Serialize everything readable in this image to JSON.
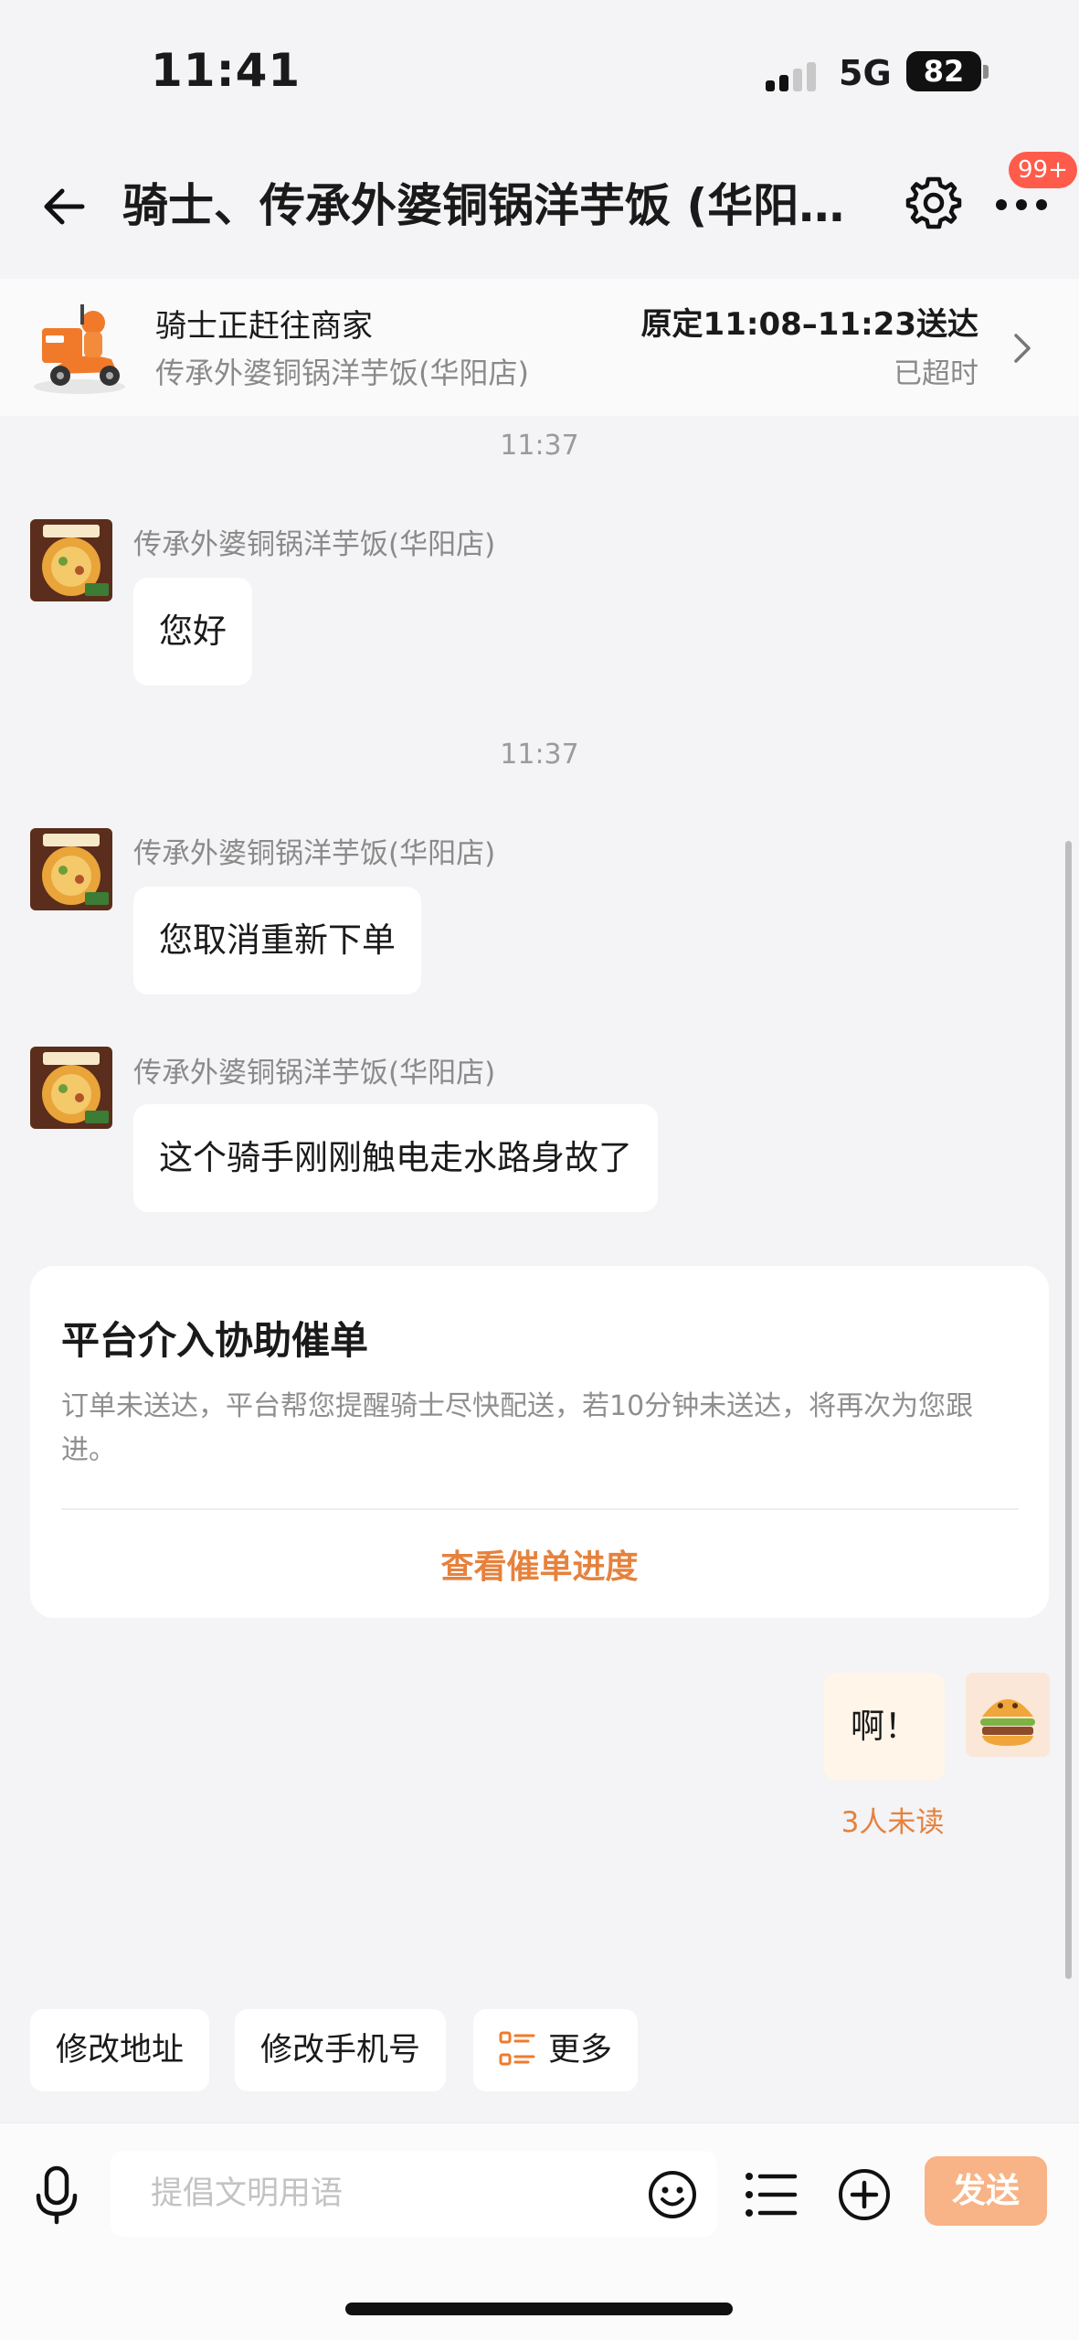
{
  "status_bar": {
    "time": "11:41",
    "network": "5G",
    "battery": "82"
  },
  "header": {
    "title": "骑士、传承外婆铜锅洋芋饭 (华阳…",
    "badge": "99+"
  },
  "order": {
    "rider_status": "骑士正赶往商家",
    "shop_name": "传承外婆铜锅洋芋饭(华阳店)",
    "eta": "原定11:08–11:23送达",
    "overtime": "已超时"
  },
  "messages": [
    {
      "time": "11:37",
      "sender": "传承外婆铜锅洋芋饭(华阳店)",
      "text": "您好"
    },
    {
      "time": "11:37",
      "sender": "传承外婆铜锅洋芋饭(华阳店)",
      "text": "您取消重新下单"
    },
    {
      "sender": "传承外婆铜锅洋芋饭(华阳店)",
      "text": "这个骑手刚刚触电走水路身故了"
    }
  ],
  "platform_card": {
    "title": "平台介入协助催单",
    "desc": "订单未送达，平台帮您提醒骑士尽快配送，若10分钟未送达，将再次为您跟进。",
    "link": "查看催单进度"
  },
  "my_message": {
    "text": "啊！",
    "unread": "3人未读"
  },
  "quick_actions": {
    "edit_address": "修改地址",
    "edit_phone": "修改手机号",
    "more": "更多"
  },
  "input": {
    "placeholder": "提倡文明用语",
    "send": "发送"
  },
  "colors": {
    "accent": "#e5823d",
    "send_bg": "#f8b386",
    "badge": "#ff5b4a"
  }
}
